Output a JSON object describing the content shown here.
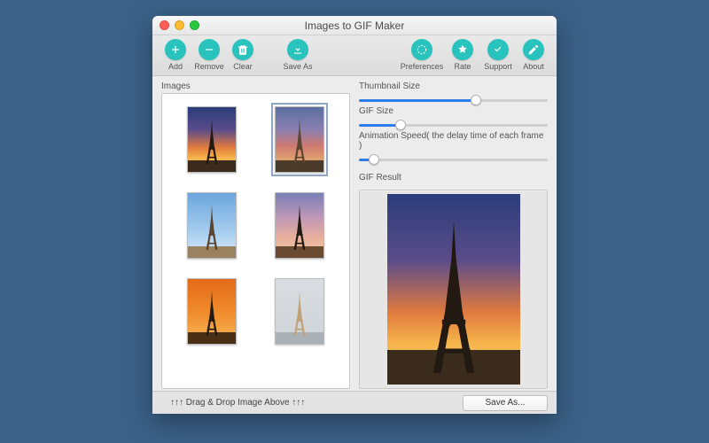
{
  "window": {
    "title": "Images to GIF Maker"
  },
  "toolbar": {
    "left": [
      {
        "name": "add-button",
        "label": "Add",
        "icon": "plus-icon"
      },
      {
        "name": "remove-button",
        "label": "Remove",
        "icon": "minus-icon"
      },
      {
        "name": "clear-button",
        "label": "Clear",
        "icon": "trash-icon"
      }
    ],
    "left2": [
      {
        "name": "save-as-button",
        "label": "Save As",
        "icon": "download-icon"
      }
    ],
    "right": [
      {
        "name": "preferences-button",
        "label": "Preferences",
        "icon": "gear-dashed-icon"
      },
      {
        "name": "rate-button",
        "label": "Rate",
        "icon": "star-icon"
      },
      {
        "name": "support-button",
        "label": "Support",
        "icon": "check-circle-icon"
      },
      {
        "name": "about-button",
        "label": "About",
        "icon": "pencil-icon"
      }
    ]
  },
  "left_panel": {
    "label": "Images",
    "thumbnails": [
      {
        "name": "thumbnail-1",
        "scene": "sunset",
        "tower": "dark",
        "selected": false
      },
      {
        "name": "thumbnail-2",
        "scene": "dusk",
        "tower": "mid",
        "selected": true
      },
      {
        "name": "thumbnail-3",
        "scene": "day",
        "tower": "mid",
        "selected": false
      },
      {
        "name": "thumbnail-4",
        "scene": "sunrise",
        "tower": "dark",
        "selected": false
      },
      {
        "name": "thumbnail-5",
        "scene": "orange",
        "tower": "dark",
        "selected": false
      },
      {
        "name": "thumbnail-6",
        "scene": "overcast",
        "tower": "light",
        "selected": false
      }
    ]
  },
  "right_panel": {
    "sliders": [
      {
        "name": "thumbnail-size-slider",
        "label": "Thumbnail Size",
        "value_pct": 62
      },
      {
        "name": "gif-size-slider",
        "label": "GIF Size",
        "value_pct": 22
      },
      {
        "name": "animation-speed-slider",
        "label": "Animation Speed( the delay time of each frame )",
        "value_pct": 8
      }
    ],
    "result_label": "GIF Result",
    "result_scene": "sunset"
  },
  "footer": {
    "hint": "↑↑↑ Drag & Drop Image Above ↑↑↑",
    "save_label": "Save As..."
  },
  "colors": {
    "accent": "#29c3bd",
    "slider_fill": "#2f7eea",
    "page_bg": "#3b6187"
  }
}
